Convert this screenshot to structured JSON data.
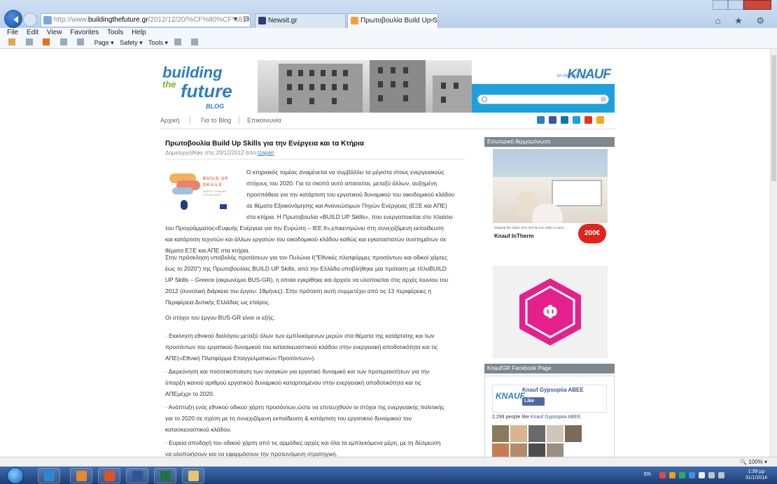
{
  "browser": {
    "address_prefix": "http://www.",
    "address_domain": "buildingthefuture.gr",
    "address_rest": "/2012/12/20/%CF%80%CF%81%CF%89%",
    "address_buttons": "▾ ⊟ C",
    "tabs": [
      {
        "label": "Newsit.gr"
      },
      {
        "label": "Πρωτοβουλία Build Up Skil...",
        "close": "×"
      }
    ],
    "right_icons": "⌂ ★ ⚙",
    "menu": [
      "File",
      "Edit",
      "View",
      "Favorites",
      "Tools",
      "Help"
    ],
    "commands": [
      "Page ▾",
      "Safety ▾",
      "Tools ▾"
    ],
    "zoom": "100%"
  },
  "site": {
    "logo": {
      "line1": "building",
      "line2": "the",
      "line3": "future",
      "line4": "BLOG"
    },
    "knauf_tagline": "An initiative by",
    "knauf_logo": "KNAUF",
    "nav": [
      "Αρχική",
      "Για το Blog",
      "Επικοινωνία"
    ],
    "social_colors": [
      "#2d7fc2",
      "#3b5998",
      "#0e76a8",
      "#1ca1dd",
      "#e53222",
      "#f5a623"
    ]
  },
  "post": {
    "title": "Πρωτοβουλία Build Up Skills για την Ενέργεια και τα Κτήρια",
    "meta_prefix": "Δημιουργήθηκε στις 20/12/2012 από",
    "meta_author": "tzapan",
    "buildup_logo_text": "BUILD UP\nSKILLS",
    "buildup_logo_sub": "ENERGY TRAINING FOR BUILDERS",
    "intro_lines": [
      "Ο κτηριακός τομέας αναμένεται να συμβάλλει τα μέγιστα στους ενεργειακούς",
      "στόχους του 2020. Για το σκοπό αυτό απαιτείται, μεταξύ άλλων, αυξημένη",
      "προσπάθεια για την κατάρτιση του εργατικού δυναμικού του οικοδομικού κλάδου",
      "σε θέματα Εξοικονόμησης και Ανανεώσιμων Πηγών Ενέργειας (ΕΞΕ και ΑΠΕ)",
      "στα κτήρια. Η Πρωτοβουλία «BUILD UP Skills», που ενεργοποιείται στο πλαίσιο"
    ],
    "intro_full_lines": [
      "του Προγράμματος«Ευφυής Ενέργεια για την Ευρώπη – ΙΕΕ ΙΙ»,επικεντρώνει στη συνεχιζόμενη εκπαίδευση",
      "και κατάρτιση τεχνιτών και άλλων εργατών του οικοδομικού κλάδου καθώς και εγκαταστατών συστημάτων σε",
      "θέματα ΕΞΕ και ΑΠΕ στα κτήρια."
    ],
    "p2_lines": [
      "Στην πρόσκληση υποβολής προτάσεων για τον Πυλώνα Ι(\"Εθνικές πλατφόρμες προσόντων και οδικοί χάρτες",
      "έως το 2020\") της Πρωτοβουλίας BUILD UP Skills, από την Ελλάδα υποβλήθηκε μία πρόταση με τίτλοBUILD",
      "UP Skills – Greece (ακρωνύμιο BUS-GR), η οποία εγκρίθηκε και άρχισε να υλοποιείται στις αρχές Ιουνίου του",
      "2012 (συνολική διάρκεια του έργου: 18μήνες). Στην πρόταση αυτή συμμετέχει από τις 13 περιφέρειες η",
      "Περιφέρεια Δυτικής Ελλάδας ως εταίρος."
    ],
    "p3": "Οι στόχοι του έργου BUS-GR είναι οι εξής:",
    "p4_lines": [
      "· Εκκίνηση εθνικού διαλόγου μεταξύ όλων των εμπλεκόμενων μερών στα θέματα της κατάρτισης και των",
      "προσόντων του εργατικού δυναμικού του κατασκευαστικού κλάδου στην ενεργειακή αποδοτικότητα και τις",
      "ΑΠΕ(«Εθνική Πλατφόρμα Επαγγελματικών Προσόντων»)."
    ],
    "p5_lines": [
      "· Διερεύνηση και ποσοτικοποίηση των αναγκών για εργατικό δυναμικό και των προτεραιοτήτων για την",
      "ύπαρξη ικανού αριθμού εργατικού δυναμικού καταρτισμένου στην ενεργειακή αποδοτικότητα και τις",
      "ΑΠΕμέχρι το 2020."
    ],
    "p6_lines": [
      "· Ανάπτυξη ενός εθνικού οδικού χάρτη προσόντων,ώστε να επιτευχθούν οι στόχοι της ενεργειακής πολιτικής",
      "για το 2020 σε σχέση με τη συνεχιζόμενη εκπαίδευση & κατάρτιση του εργατικού δυναμικού του",
      "κατασκευαστικού κλάδου."
    ],
    "p7_lines": [
      "· Ευρεία αποδοχή του οδικού χάρτη από τις αρμόδιες αρχές και όλα τα εμπλεκόμενα μέρη, με τη δέσμευση",
      "να υλοποιήσουν και να εφαρμόσουν την προτεινόμενη στρατηγική."
    ]
  },
  "sidebar": {
    "ad1_header": "Εσωτερική θερμομόνωση",
    "ad1_small": "Σταμάτα δεν ξέρεις από πού θα σου έρθει το κρύο...",
    "ad1_name": "Knauf InTherm",
    "ad1_badge": "200€",
    "ad2_glyph": "Φ",
    "ad2_color": "#e5208c",
    "fb_header": "KnaufGR Facebook Page",
    "fb_logo": "KNAUF",
    "fb_name": "Knauf Gypsopiia ABEE",
    "fb_like": "Like",
    "fb_count_prefix": "2,299 people like",
    "fb_count_link": "Knauf Gypsopiia ABEE."
  },
  "taskbar": {
    "lang": "EN",
    "time": "1:39 μμ",
    "date": "31/1/2014"
  }
}
